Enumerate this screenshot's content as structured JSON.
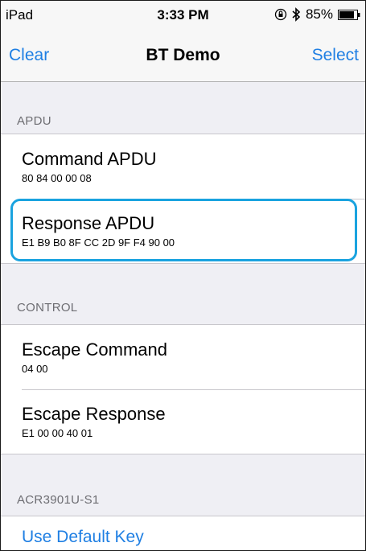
{
  "status_bar": {
    "carrier": "iPad",
    "time": "3:33 PM",
    "battery": "85%"
  },
  "nav": {
    "left_label": "Clear",
    "title": "BT Demo",
    "right_label": "Select"
  },
  "sections": {
    "apdu": {
      "header": "APDU",
      "command": {
        "title": "Command APDU",
        "value": "80 84 00 00 08"
      },
      "response": {
        "title": "Response APDU",
        "value": "E1 B9 B0 8F CC 2D 9F F4 90 00"
      }
    },
    "control": {
      "header": "CONTROL",
      "escape_command": {
        "title": "Escape Command",
        "value": "04 00"
      },
      "escape_response": {
        "title": "Escape Response",
        "value": "E1 00 00 40 01"
      }
    },
    "device": {
      "header": "ACR3901U-S1",
      "use_default_key": "Use Default Key"
    }
  },
  "colors": {
    "accent": "#1f7fe3",
    "highlight": "#1aa3df",
    "background": "#efeff4"
  },
  "icons": [
    "orientation-lock-icon",
    "bluetooth-icon",
    "battery-icon"
  ]
}
